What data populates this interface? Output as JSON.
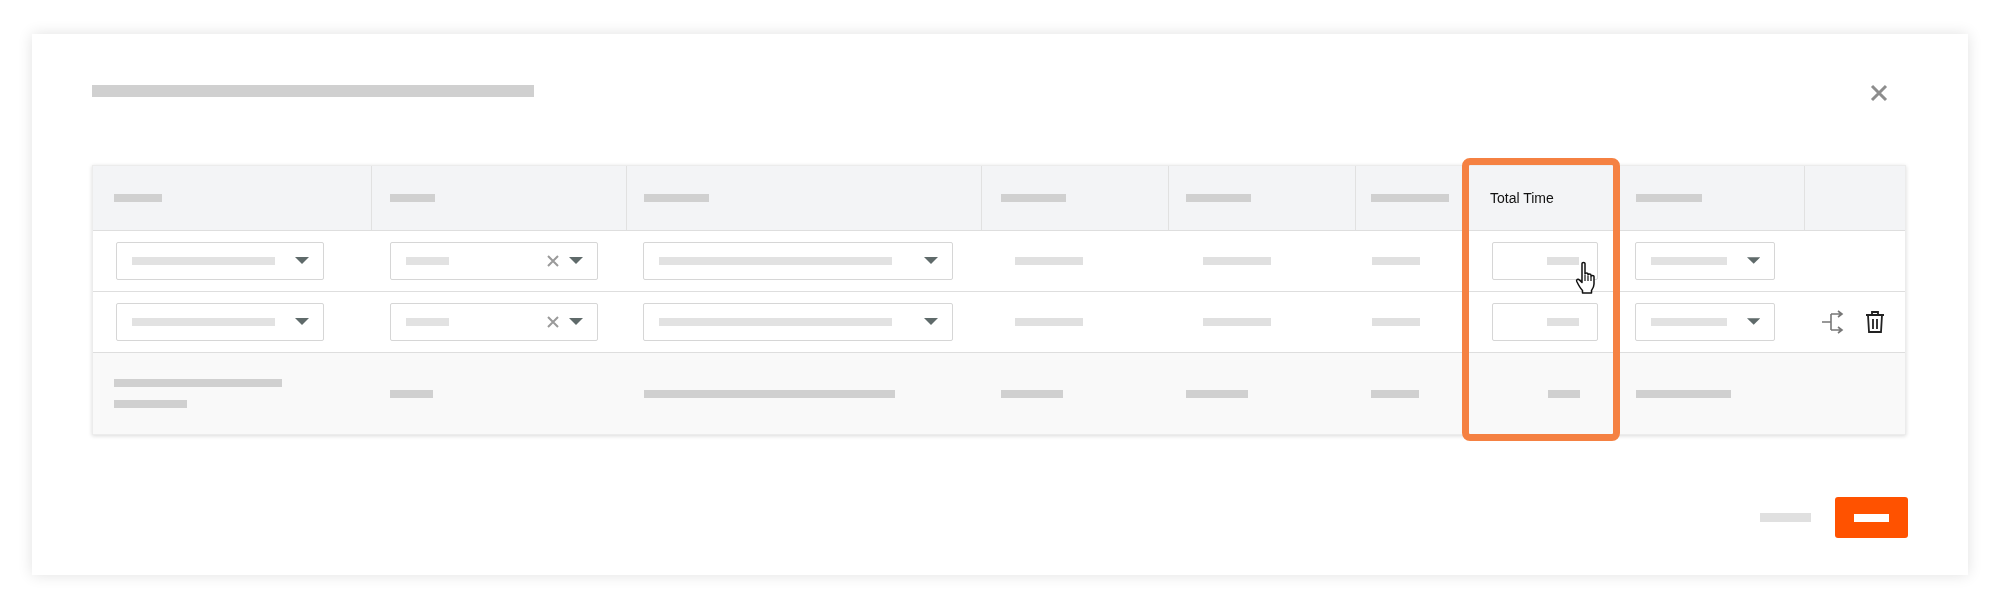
{
  "dialog": {
    "title": {
      "kind": "placeholder"
    },
    "close": {
      "kind": "close"
    }
  },
  "header_columns": [
    {
      "kind": "placeholder"
    },
    {
      "kind": "placeholder"
    },
    {
      "kind": "placeholder"
    },
    {
      "kind": "placeholder"
    },
    {
      "kind": "placeholder"
    },
    {
      "kind": "placeholder"
    },
    {
      "kind": "label",
      "label": "Total Time",
      "highlighted": true
    },
    {
      "kind": "placeholder"
    },
    {
      "kind": "empty"
    }
  ],
  "rows": [
    {
      "cells": [
        {
          "kind": "select"
        },
        {
          "kind": "clearable-select"
        },
        {
          "kind": "select"
        },
        {
          "kind": "bar"
        },
        {
          "kind": "bar"
        },
        {
          "kind": "bar"
        },
        {
          "kind": "input",
          "hovered": true
        },
        {
          "kind": "select"
        },
        {
          "kind": "empty"
        }
      ]
    },
    {
      "cells": [
        {
          "kind": "select"
        },
        {
          "kind": "clearable-select"
        },
        {
          "kind": "select"
        },
        {
          "kind": "bar"
        },
        {
          "kind": "bar"
        },
        {
          "kind": "bar"
        },
        {
          "kind": "input",
          "hovered": false
        },
        {
          "kind": "select"
        },
        {
          "kind": "actions"
        }
      ]
    }
  ],
  "footer_row": [
    {
      "kind": "double-bar"
    },
    {
      "kind": "bar"
    },
    {
      "kind": "bar"
    },
    {
      "kind": "bar"
    },
    {
      "kind": "bar"
    },
    {
      "kind": "bar"
    },
    {
      "kind": "bar"
    },
    {
      "kind": "bar"
    },
    {
      "kind": "empty"
    }
  ],
  "buttons": [
    {
      "kind": "secondary"
    },
    {
      "kind": "primary"
    }
  ]
}
